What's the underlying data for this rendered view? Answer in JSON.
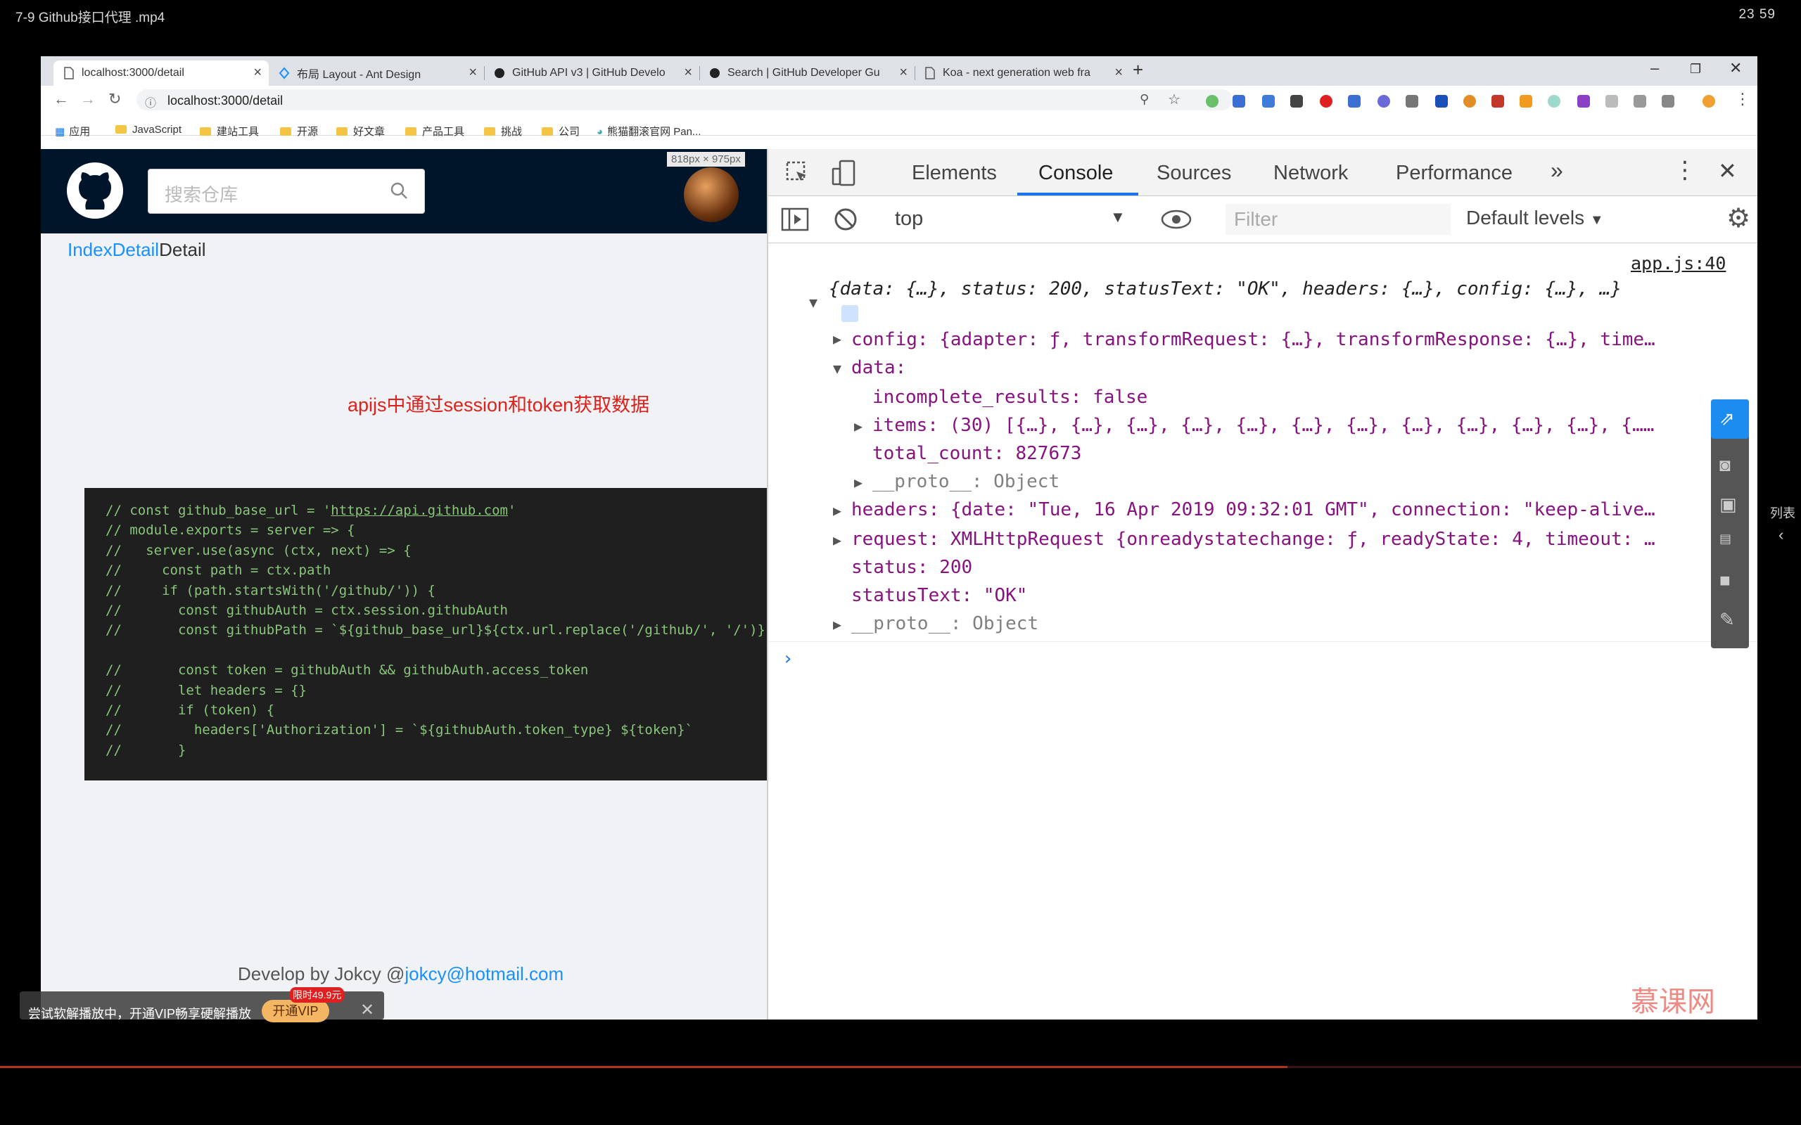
{
  "player": {
    "title": "7-9 Github接口代理 .mp4",
    "time": "23  59",
    "side_label": "列表"
  },
  "browser": {
    "tabs": [
      {
        "title": "localhost:3000/detail"
      },
      {
        "title": "布局 Layout - Ant Design"
      },
      {
        "title": "GitHub API v3 | GitHub Develo"
      },
      {
        "title": "Search | GitHub Developer Gu"
      },
      {
        "title": "Koa - next generation web fra"
      }
    ],
    "address": "localhost:3000/detail",
    "bookmarks": [
      "应用",
      "JavaScript",
      "建站工具",
      "开源",
      "好文章",
      "产品工具",
      "挑战",
      "公司",
      "熊猫翻滚官网 Pan..."
    ]
  },
  "page": {
    "search_placeholder": "搜索仓库",
    "dims": "818px × 975px",
    "breadcrumb_link": "IndexDetail",
    "breadcrumb_current": "Detail",
    "annotation": "apijs中通过session和token获取数据",
    "code_lines": [
      "// const github_base_url = 'https://api.github.com'",
      "// module.exports = server => {",
      "//   server.use(async (ctx, next) => {",
      "//     const path = ctx.path",
      "//     if (path.startsWith('/github/')) {",
      "//       const githubAuth = ctx.session.githubAuth",
      "//       const githubPath = `${github_base_url}${ctx.url.replace('/github/', '/')}`",
      "",
      "//       const token = githubAuth && githubAuth.access_token",
      "//       let headers = {}",
      "//       if (token) {",
      "//         headers['Authorization'] = `${githubAuth.token_type} ${token}`",
      "//       }"
    ],
    "footer_text": "Develop by Jokcy @",
    "footer_email": "jokcy@hotmail.com"
  },
  "devtools": {
    "tabs": [
      "Elements",
      "Console",
      "Sources",
      "Network",
      "Performance"
    ],
    "context": "top",
    "filter_placeholder": "Filter",
    "levels": "Default levels",
    "source_link": "app.js:40",
    "summary": "{data: {…}, status: 200, statusText: \"OK\", headers: {…}, config: {…}, …}",
    "config_line": "config: {adapter: ƒ, transformRequest: {…}, transformResponse: {…}, time…",
    "data_key": "data:",
    "incomplete_results": "incomplete_results: false",
    "items_line": "items: (30) [{…}, {…}, {…}, {…}, {…}, {…}, {…}, {…}, {…}, {…}, {…}, {……",
    "total_count": "total_count: 827673",
    "proto_inner": "__proto__: Object",
    "headers_line": "headers: {date: \"Tue, 16 Apr 2019 09:32:01 GMT\", connection: \"keep-alive…",
    "request_line": "request: XMLHttpRequest {onreadystatechange: ƒ, readyState: 4, timeout: …",
    "status": "status: 200",
    "statusText": "statusText: \"OK\"",
    "proto_outer": "__proto__: Object"
  },
  "overlay": {
    "vip_text": "尝试软解播放中，开通VIP畅享硬解播放",
    "vip_button": "开通VIP",
    "vip_badge": "限时49.9元",
    "logo": "慕课网"
  }
}
